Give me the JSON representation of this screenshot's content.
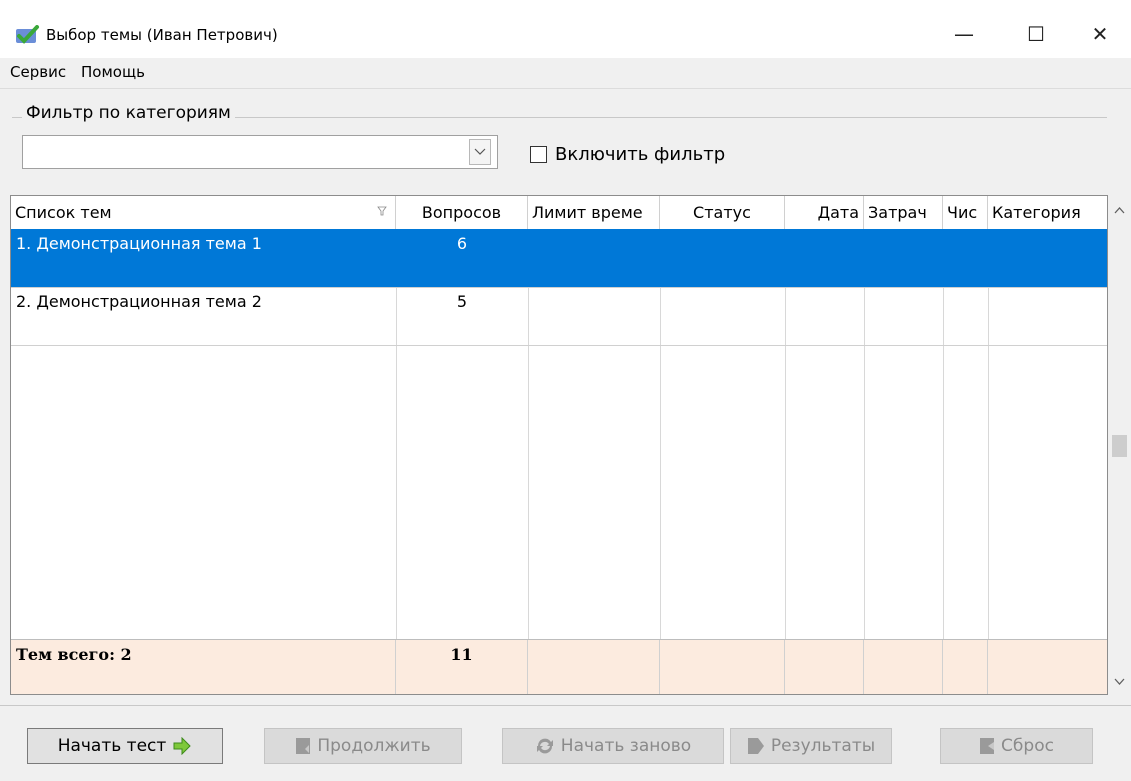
{
  "window": {
    "title": "Выбор темы (Иван Петрович)",
    "min_glyph": "—",
    "max_glyph": "☐",
    "close_glyph": "✕"
  },
  "menu": {
    "items": [
      "Сервис",
      "Помощь"
    ]
  },
  "filter": {
    "group_label": "Фильтр по категориям",
    "combo_value": "",
    "checkbox_label": "Включить фильтр",
    "checkbox_checked": false
  },
  "table": {
    "headers": [
      "Список тем",
      "Вопросов",
      "Лимит време",
      "Статус",
      "Дата",
      "Затрач",
      "Чис",
      "Категория"
    ],
    "rows": [
      {
        "title": "1. Демонстрационная тема 1",
        "questions": "6",
        "selected": true
      },
      {
        "title": "2. Демонстрационная тема 2",
        "questions": "5",
        "selected": false
      }
    ],
    "footer": {
      "label": "Тем всего: 2",
      "total": "11"
    }
  },
  "buttons": {
    "start": "Начать тест",
    "continue": "Продолжить",
    "restart": "Начать заново",
    "results": "Результаты",
    "reset": "Сброс"
  },
  "colors": {
    "selection": "#0078d7",
    "footer_bg": "#fcebdf"
  }
}
